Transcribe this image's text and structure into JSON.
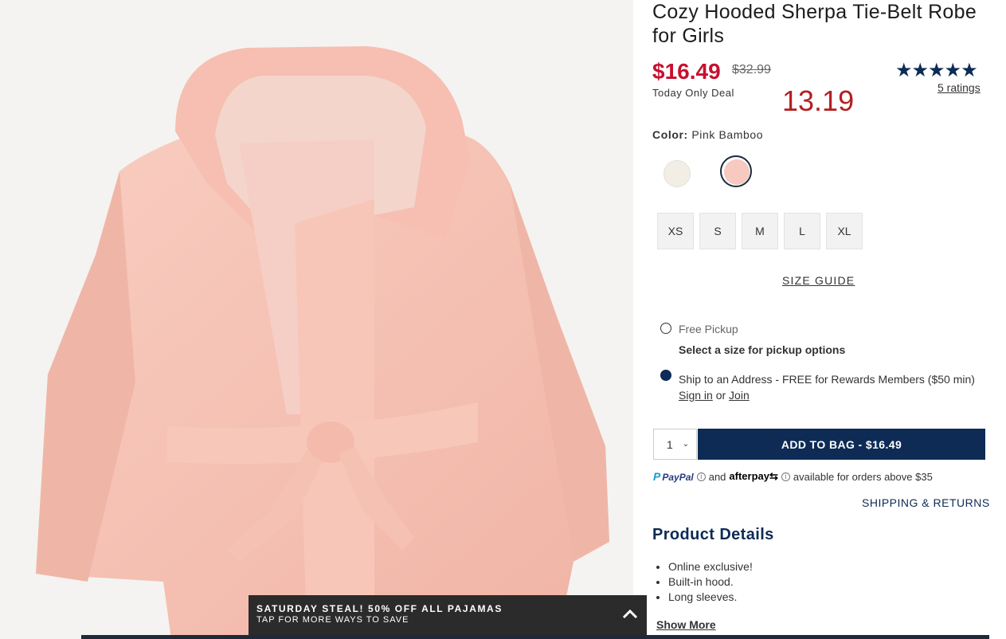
{
  "product": {
    "title": "Cozy Hooded Sherpa Tie-Belt Robe for Girls",
    "image_alt": "pink-sherpa-robe-photo"
  },
  "pricing": {
    "sale_price": "$16.49",
    "original_price": "$32.99",
    "deal_label": "Today Only Deal",
    "overlay_value": "13.19"
  },
  "ratings": {
    "stars": "★★★★★",
    "rating_value": 5,
    "link_text": "5 ratings"
  },
  "color": {
    "label": "Color:",
    "selected": "Pink Bamboo",
    "swatches": [
      {
        "name": "cream",
        "hex": "#f2eee6"
      },
      {
        "name": "pink-bamboo",
        "hex": "#f7c9c0"
      }
    ]
  },
  "sizes": [
    "XS",
    "S",
    "M",
    "L",
    "XL"
  ],
  "size_guide": "SIZE GUIDE",
  "fulfillment": {
    "pickup_label": "Free Pickup",
    "pickup_note": "Select a size for pickup options",
    "ship_text": "Ship to an Address - FREE for Rewards Members ($50 min)",
    "sign_in": "Sign in",
    "or": "or",
    "join": "Join"
  },
  "cart": {
    "quantity": "1",
    "add_label": "ADD TO BAG  -  $16.49"
  },
  "payment": {
    "paypal": "PayPal",
    "and": "and",
    "afterpay": "afterpay",
    "availability": "available for orders above $35"
  },
  "shipping_returns": "SHIPPING & RETURNS",
  "details": {
    "title": "Product Details",
    "bullets": [
      "Online exclusive!",
      "Built-in hood.",
      "Long sleeves."
    ],
    "show_more": "Show More"
  },
  "promo": {
    "title": "SATURDAY STEAL! 50% OFF ALL PAJAMAS",
    "subtitle": "TAP FOR MORE WAYS TO SAVE"
  },
  "colors": {
    "brand_navy": "#0d2b55",
    "sale_red": "#c8102e",
    "robe_pink": "#f7c4b6"
  }
}
